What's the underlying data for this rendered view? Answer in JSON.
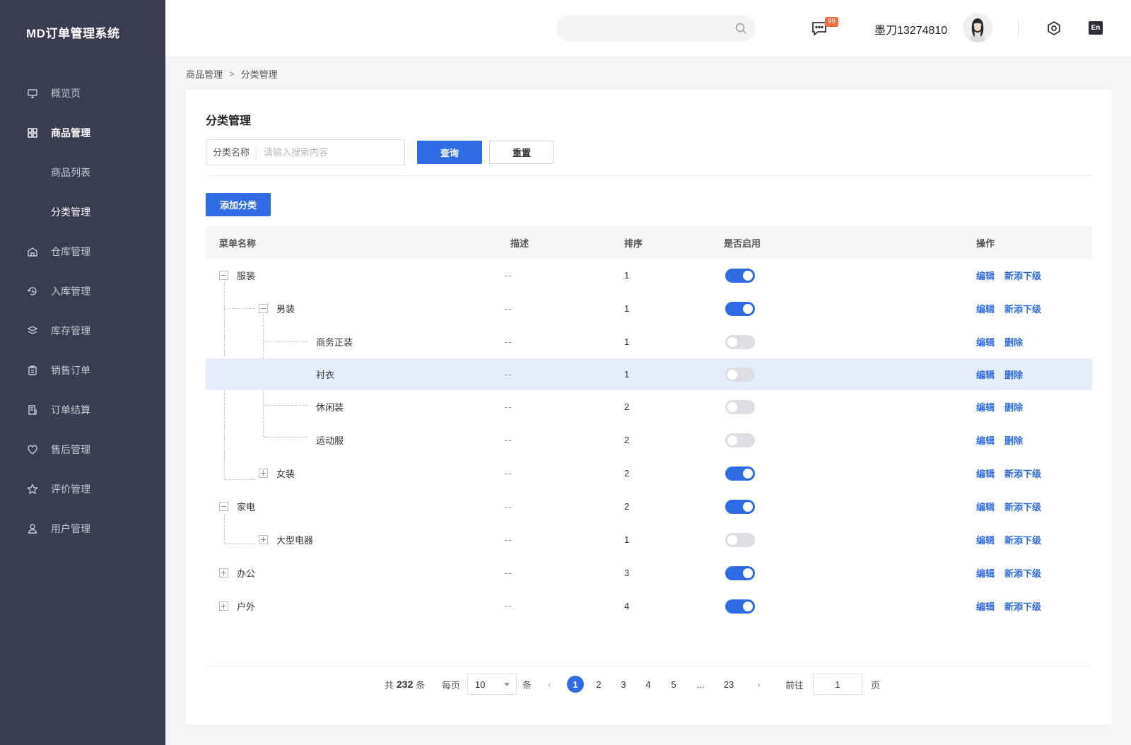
{
  "app": {
    "title": "MD订单管理系统"
  },
  "sidebar": {
    "items": [
      {
        "label": "概览页",
        "icon": "monitor-icon"
      },
      {
        "label": "商品管理",
        "icon": "grid-icon"
      },
      {
        "label": "商品列表"
      },
      {
        "label": "分类管理"
      },
      {
        "label": "仓库管理",
        "icon": "warehouse-icon"
      },
      {
        "label": "入库管理",
        "icon": "inbound-icon"
      },
      {
        "label": "库存管理",
        "icon": "layers-icon"
      },
      {
        "label": "销售订单",
        "icon": "clipboard-icon"
      },
      {
        "label": "订单结算",
        "icon": "receipt-icon"
      },
      {
        "label": "售后管理",
        "icon": "heart-icon"
      },
      {
        "label": "评价管理",
        "icon": "star-icon"
      },
      {
        "label": "用户管理",
        "icon": "user-icon"
      }
    ]
  },
  "header": {
    "search_placeholder": "",
    "message_badge": "99",
    "username": "墨刀13274810",
    "lang": "En"
  },
  "breadcrumb": {
    "parent": "商品管理",
    "sep": ">",
    "current": "分类管理"
  },
  "page": {
    "title": "分类管理",
    "filter_label": "分类名称",
    "filter_placeholder": "请输入搜索内容",
    "query_label": "查询",
    "reset_label": "重置",
    "add_label": "添加分类"
  },
  "table": {
    "headers": {
      "name": "菜单名称",
      "desc": "描述",
      "sort": "排序",
      "enabled": "是否启用",
      "ops": "操作"
    },
    "rows": [
      {
        "name": "服装",
        "desc": "--",
        "sort": "1",
        "enabled": true,
        "op1": "编辑",
        "op2": "新添下级"
      },
      {
        "name": "男装",
        "desc": "--",
        "sort": "1",
        "enabled": true,
        "op1": "编辑",
        "op2": "新添下级"
      },
      {
        "name": "商务正装",
        "desc": "--",
        "sort": "1",
        "enabled": false,
        "op1": "编辑",
        "op2": "删除"
      },
      {
        "name": "衬衣",
        "desc": "--",
        "sort": "1",
        "enabled": false,
        "op1": "编辑",
        "op2": "删除"
      },
      {
        "name": "休闲装",
        "desc": "--",
        "sort": "2",
        "enabled": false,
        "op1": "编辑",
        "op2": "删除"
      },
      {
        "name": "运动服",
        "desc": "--",
        "sort": "2",
        "enabled": false,
        "op1": "编辑",
        "op2": "删除"
      },
      {
        "name": "女装",
        "desc": "--",
        "sort": "2",
        "enabled": true,
        "op1": "编辑",
        "op2": "新添下级"
      },
      {
        "name": "家电",
        "desc": "--",
        "sort": "2",
        "enabled": true,
        "op1": "编辑",
        "op2": "新添下级"
      },
      {
        "name": "大型电器",
        "desc": "--",
        "sort": "1",
        "enabled": false,
        "op1": "编辑",
        "op2": "新添下级"
      },
      {
        "name": "办公",
        "desc": "--",
        "sort": "3",
        "enabled": true,
        "op1": "编辑",
        "op2": "新添下级"
      },
      {
        "name": "户外",
        "desc": "--",
        "sort": "4",
        "enabled": true,
        "op1": "编辑",
        "op2": "新添下级"
      }
    ]
  },
  "pagination": {
    "total_prefix": "共",
    "total": "232",
    "total_suffix": "条",
    "per_page_label": "每页",
    "per_page": "10",
    "per_page_unit": "条",
    "pages": [
      "1",
      "2",
      "3",
      "4",
      "5",
      "...",
      "23"
    ],
    "current": "1",
    "goto_label": "前往",
    "goto_value": "1",
    "goto_unit": "页"
  }
}
